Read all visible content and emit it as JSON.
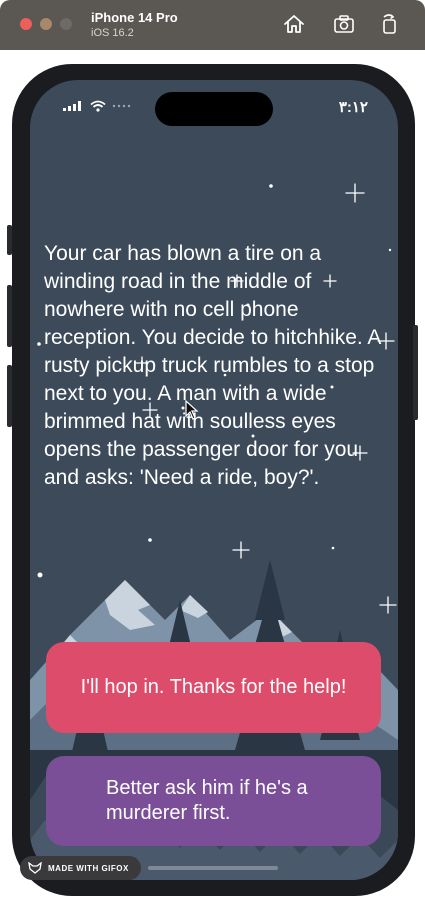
{
  "simulator": {
    "device_name": "iPhone 14 Pro",
    "os_version": "iOS 16.2",
    "buttons": [
      "home-icon",
      "screenshot-icon",
      "rotate-icon"
    ]
  },
  "status_bar": {
    "time": "٣:١٢"
  },
  "story": {
    "text": "Your car has blown a tire on a winding road in the middle of nowhere with no cell phone reception. You decide to hitchhike. A rusty pickup truck rumbles to a stop next to you. A man with a wide brimmed hat with soulless eyes opens the passenger door for you and asks: 'Need a ride, boy?'."
  },
  "choices": [
    {
      "label": "I'll hop in. Thanks for the help!",
      "color": "#de4c6b"
    },
    {
      "label": "Better ask him if he's a murderer first.",
      "color": "#7a4f98"
    }
  ],
  "watermark": {
    "label": "MADE WITH GIFOX"
  },
  "colors": {
    "background": "#3c4a5a",
    "mountain": "#7e92a8",
    "snow": "#c9d4df",
    "trees": "#2a3644"
  }
}
